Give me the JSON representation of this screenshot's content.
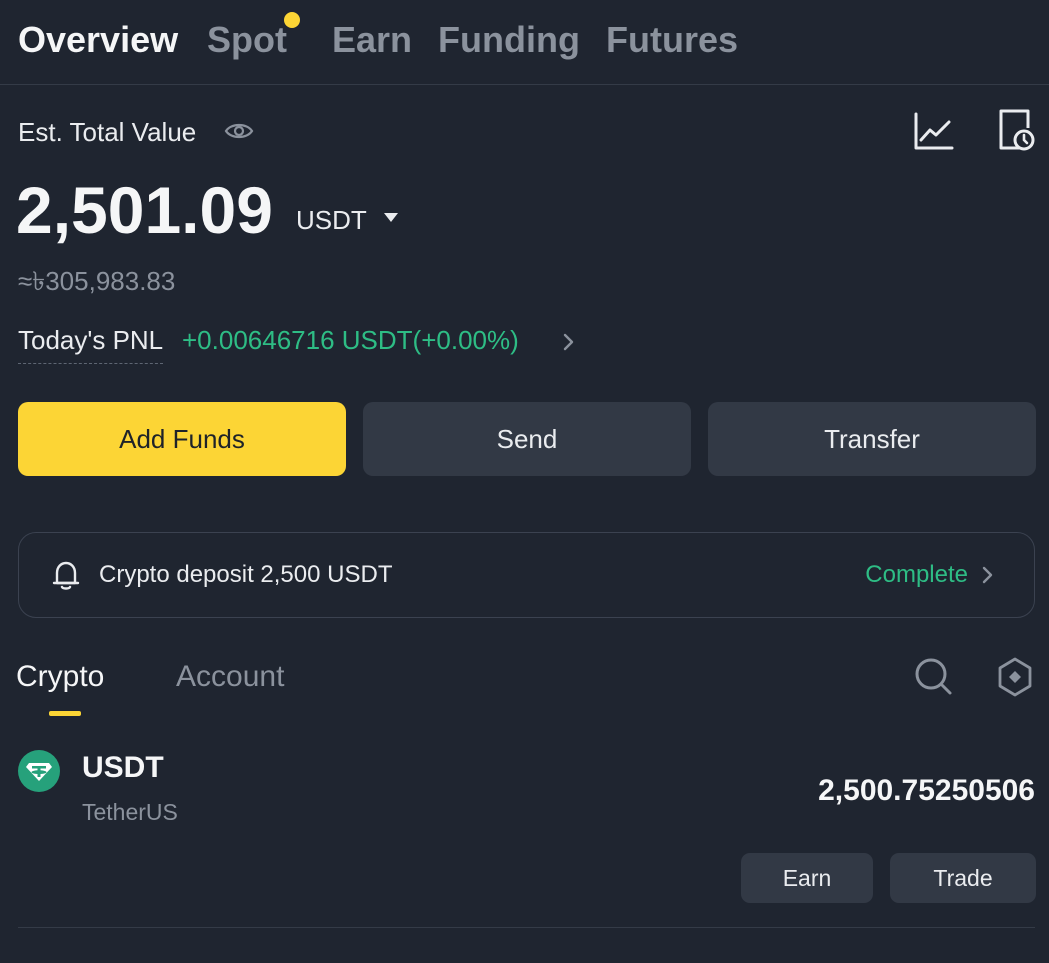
{
  "top_tabs": [
    {
      "label": "Overview",
      "active": true
    },
    {
      "label": "Spot",
      "active": false,
      "has_dot": true
    },
    {
      "label": "Earn",
      "active": false
    },
    {
      "label": "Funding",
      "active": false
    },
    {
      "label": "Futures",
      "active": false
    }
  ],
  "summary": {
    "est_label": "Est. Total Value",
    "total_value": "2,501.09",
    "unit": "USDT",
    "fiat_value": "≈৳305,983.83",
    "pnl_label": "Today's PNL",
    "pnl_value": "+0.00646716 USDT(+0.00%)"
  },
  "actions": {
    "add_funds": "Add Funds",
    "send": "Send",
    "transfer": "Transfer"
  },
  "notice": {
    "text": "Crypto deposit 2,500 USDT",
    "status": "Complete"
  },
  "sub_tabs": [
    {
      "label": "Crypto",
      "active": true
    },
    {
      "label": "Account",
      "active": false
    }
  ],
  "assets": [
    {
      "symbol": "USDT",
      "name": "TetherUS",
      "amount": "2,500.75250506",
      "earn_label": "Earn",
      "trade_label": "Trade"
    }
  ],
  "colors": {
    "background": "#1f2530",
    "accent": "#fcd535",
    "positive": "#2ebd85",
    "muted": "#8b929d",
    "button": "#323945",
    "tether": "#26a17b"
  },
  "icons": [
    "eye-icon",
    "chart-icon",
    "history-icon",
    "caret-down-icon",
    "chevron-right-icon",
    "bell-icon",
    "search-icon",
    "hexagon-icon",
    "tether-icon"
  ]
}
